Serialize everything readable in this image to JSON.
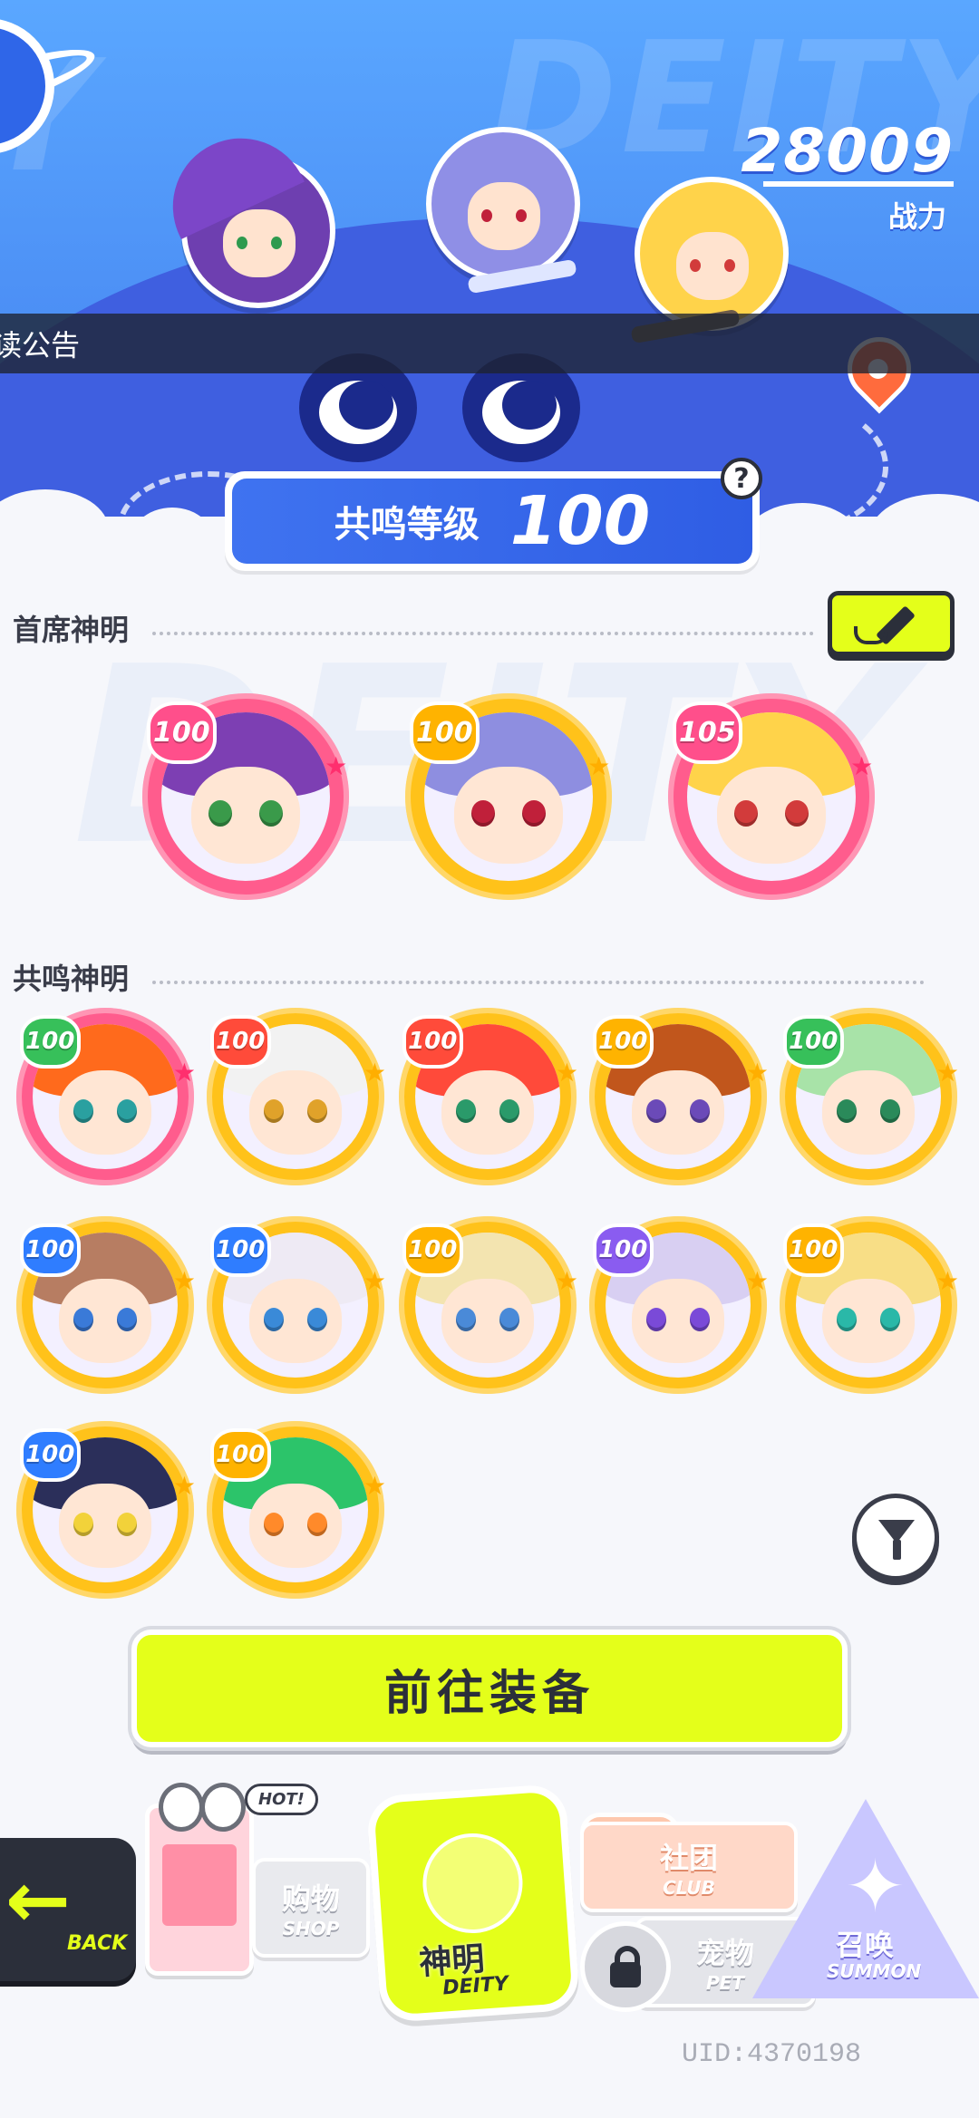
{
  "header": {
    "combat_power": "28009",
    "combat_power_label": "战力",
    "announcement": "读公告",
    "watermark": "DEITY",
    "resonance_level_label": "共鸣等级",
    "resonance_level_value": "100",
    "help_icon": "question-icon"
  },
  "sections": {
    "chief_title": "首席神明",
    "resonance_title": "共鸣神明",
    "bg_watermark": "DEITY"
  },
  "chief_deities": [
    {
      "level": "100",
      "ring": "pink",
      "hair": "#7d3fb3",
      "eye": "#3a9a4a"
    },
    {
      "level": "100",
      "ring": "gold",
      "hair": "#8e8ee0",
      "eye": "#c0203a"
    },
    {
      "level": "105",
      "ring": "pink",
      "hair": "#ffd34a",
      "eye": "#d23b3b"
    }
  ],
  "resonance_deities": [
    {
      "level": "100",
      "ring": "pink",
      "hair": "#ff6a1c",
      "eye": "#2aa0a0",
      "lvl": "green"
    },
    {
      "level": "100",
      "ring": "gold",
      "hair": "#f2f2f2",
      "eye": "#e0a22a",
      "lvl": "red"
    },
    {
      "level": "100",
      "ring": "gold",
      "hair": "#ff4a3a",
      "eye": "#2a9a6a",
      "lvl": "red"
    },
    {
      "level": "100",
      "ring": "gold",
      "hair": "#c1561c",
      "eye": "#6b4ab8",
      "lvl": "gold"
    },
    {
      "level": "100",
      "ring": "gold",
      "hair": "#a8e3a8",
      "eye": "#2a8a5a",
      "lvl": "green"
    },
    {
      "level": "100",
      "ring": "gold",
      "hair": "#b77d62",
      "eye": "#3a7ad8",
      "lvl": "blue"
    },
    {
      "level": "100",
      "ring": "gold",
      "hair": "#eeeaf4",
      "eye": "#3a8ad8",
      "lvl": "blue"
    },
    {
      "level": "100",
      "ring": "gold",
      "hair": "#f3e4b0",
      "eye": "#4a8ad8",
      "lvl": "gold"
    },
    {
      "level": "100",
      "ring": "gold",
      "hair": "#d8cff2",
      "eye": "#7a4ad8",
      "lvl": "purple"
    },
    {
      "level": "100",
      "ring": "gold",
      "hair": "#f8de86",
      "eye": "#2ab8a8",
      "lvl": "gold"
    },
    {
      "level": "100",
      "ring": "gold",
      "hair": "#2b2f5a",
      "eye": "#f2d23a",
      "lvl": "blue"
    },
    {
      "level": "100",
      "ring": "gold",
      "hair": "#2cc46a",
      "eye": "#ff8a2a",
      "lvl": "gold"
    }
  ],
  "actions": {
    "equip_button": "前往装备",
    "filter_icon": "filter-icon",
    "edit_icon": "pencil-icon"
  },
  "bottom_nav": {
    "back": "BACK",
    "shop_cn": "购物",
    "shop_en": "SHOP",
    "hot": "HOT!",
    "deity_cn": "神明",
    "deity_en": "DEITY",
    "club_cn": "社团",
    "club_en": "CLUB",
    "pet_cn": "宠物",
    "pet_en": "PET",
    "summon_cn": "召唤",
    "summon_en": "SUMMON"
  },
  "uid": "UID:4370198",
  "colors": {
    "accent_yellow": "#e4ff1a",
    "header_blue": "#4c8ff5",
    "ring_pink": "#ff5c8d",
    "ring_gold": "#ffc21a"
  }
}
